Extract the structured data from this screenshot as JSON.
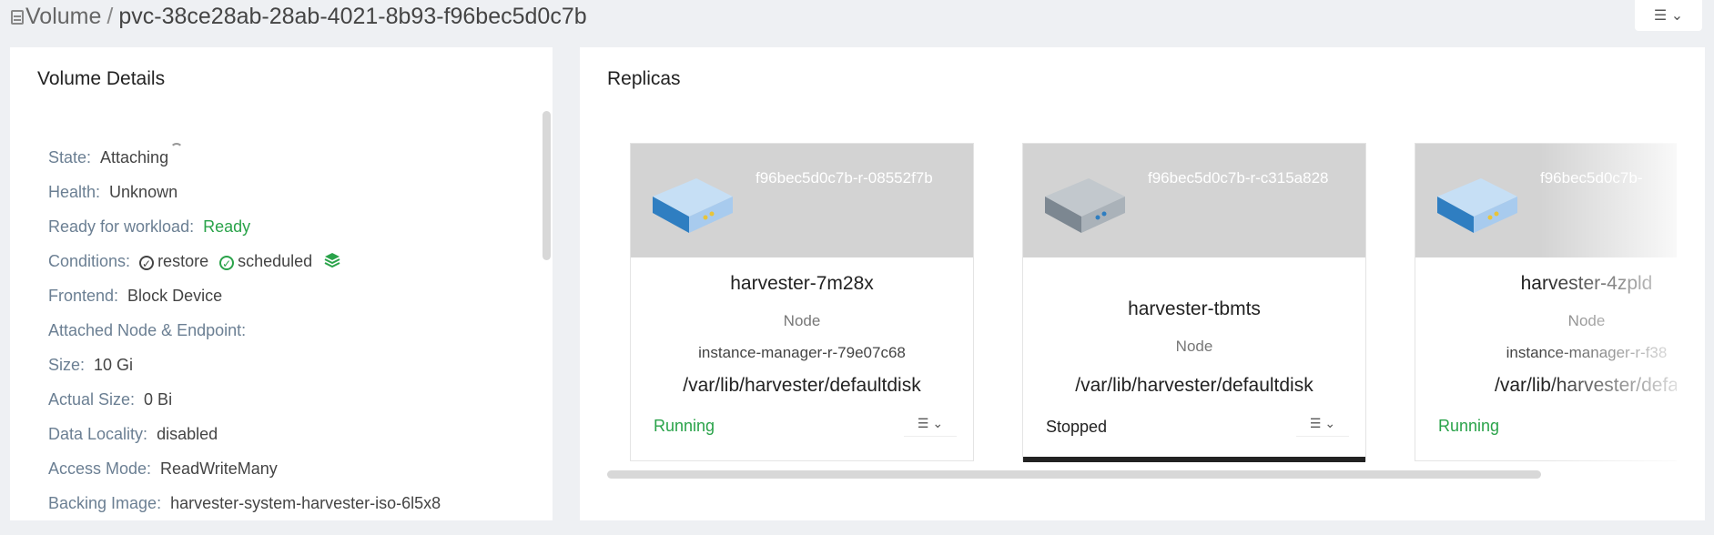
{
  "header": {
    "section": "Volume",
    "separator": "/",
    "volume_name": "pvc-38ce28ab-28ab-4021-8b93-f96bec5d0c7b",
    "menu_icon": "list-icon"
  },
  "details": {
    "title": "Volume Details",
    "state": {
      "label": "State:",
      "value": "Attaching"
    },
    "health": {
      "label": "Health:",
      "value": "Unknown"
    },
    "ready": {
      "label": "Ready for workload:",
      "value": "Ready"
    },
    "conditions": {
      "label": "Conditions:",
      "items": [
        "restore",
        "scheduled"
      ]
    },
    "frontend": {
      "label": "Frontend:",
      "value": "Block Device"
    },
    "attached": {
      "label": "Attached Node & Endpoint:",
      "value": ""
    },
    "size": {
      "label": "Size:",
      "value": "10 Gi"
    },
    "actual_size": {
      "label": "Actual Size:",
      "value": "0 Bi"
    },
    "data_locality": {
      "label": "Data Locality:",
      "value": "disabled"
    },
    "access_mode": {
      "label": "Access Mode:",
      "value": "ReadWriteMany"
    },
    "backing_image": {
      "label": "Backing Image:",
      "value": "harvester-system-harvester-iso-6l5x8"
    }
  },
  "replicas": {
    "title": "Replicas",
    "items": [
      {
        "id": "f96bec5d0c7b-r-08552f7b",
        "host": "harvester-7m28x",
        "node_label": "Node",
        "instance": "instance-manager-r-79e07c68",
        "path": "/var/lib/harvester/defaultdisk",
        "status": "Running"
      },
      {
        "id": "f96bec5d0c7b-r-c315a828",
        "host": "harvester-tbmts",
        "node_label": "Node",
        "instance": "",
        "path": "/var/lib/harvester/defaultdisk",
        "status": "Stopped"
      },
      {
        "id": "f96bec5d0c7b-",
        "host": "harvester-4zpld",
        "node_label": "Node",
        "instance": "instance-manager-r-f38",
        "path": "/var/lib/harvester/defa",
        "status": "Running"
      }
    ]
  },
  "colors": {
    "success": "#2aa34a",
    "server_blue": "#2f7ec1",
    "server_grey": "#7c8791"
  }
}
